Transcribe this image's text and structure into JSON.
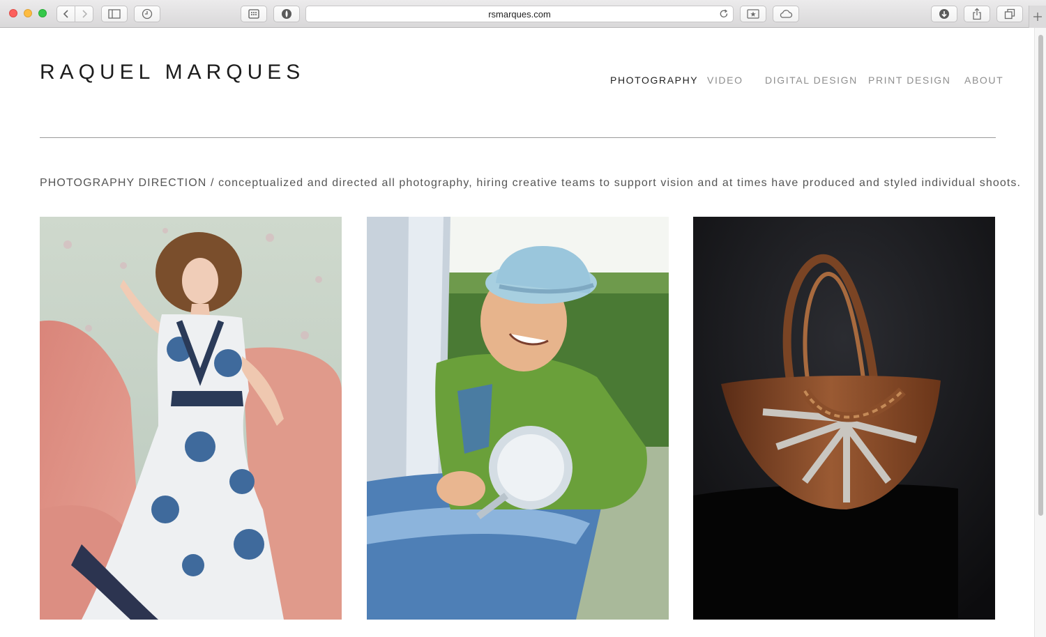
{
  "browser": {
    "url": "rsmarques.com",
    "icons": {
      "back": "chevron-left-icon",
      "forward": "chevron-right-icon",
      "sidebar": "sidebar-icon",
      "history": "history-clock-icon",
      "top_sites": "grid-icon",
      "privacy": "privacy-shield-icon",
      "reload": "reload-icon",
      "reader": "star-icon",
      "cloud": "cloud-icon",
      "downloads": "download-icon",
      "share": "share-icon",
      "tabs": "tabs-icon",
      "new_tab": "plus-icon"
    },
    "traffic_lights": [
      "#fc605c",
      "#fdbc40",
      "#34c84a"
    ]
  },
  "site": {
    "logo": "RAQUEL MARQUES",
    "nav": [
      {
        "label": "PHOTOGRAPHY",
        "active": true
      },
      {
        "label": "VIDEO",
        "active": false
      },
      {
        "label": "DIGITAL DESIGN",
        "active": false
      },
      {
        "label": "PRINT DESIGN",
        "active": false
      },
      {
        "label": "ABOUT",
        "active": false
      }
    ],
    "intro": "PHOTOGRAPHY DIRECTION / conceptualized and directed all photography, hiring creative teams to support vision and at times have produced and styled individual shoots.",
    "photos": [
      {
        "subject": "woman in floral dress on pink sofa"
      },
      {
        "subject": "man in blue hat leaning out of car window"
      },
      {
        "subject": "brown leather handbag on dark background"
      }
    ]
  }
}
